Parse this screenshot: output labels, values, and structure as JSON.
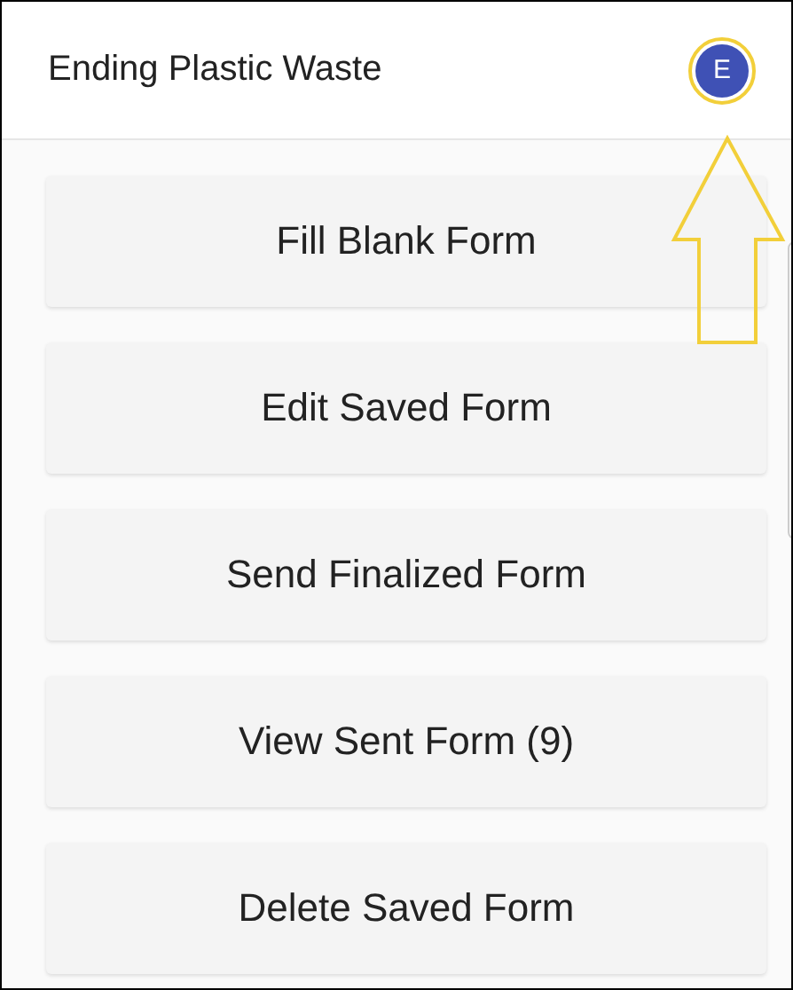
{
  "app_bar": {
    "title": "Ending Plastic Waste",
    "avatar_letter": "E"
  },
  "menu": [
    {
      "label": "Fill Blank Form"
    },
    {
      "label": "Edit Saved Form"
    },
    {
      "label": "Send Finalized Form"
    },
    {
      "label": "View Sent Form (9)"
    },
    {
      "label": "Delete Saved Form"
    }
  ]
}
